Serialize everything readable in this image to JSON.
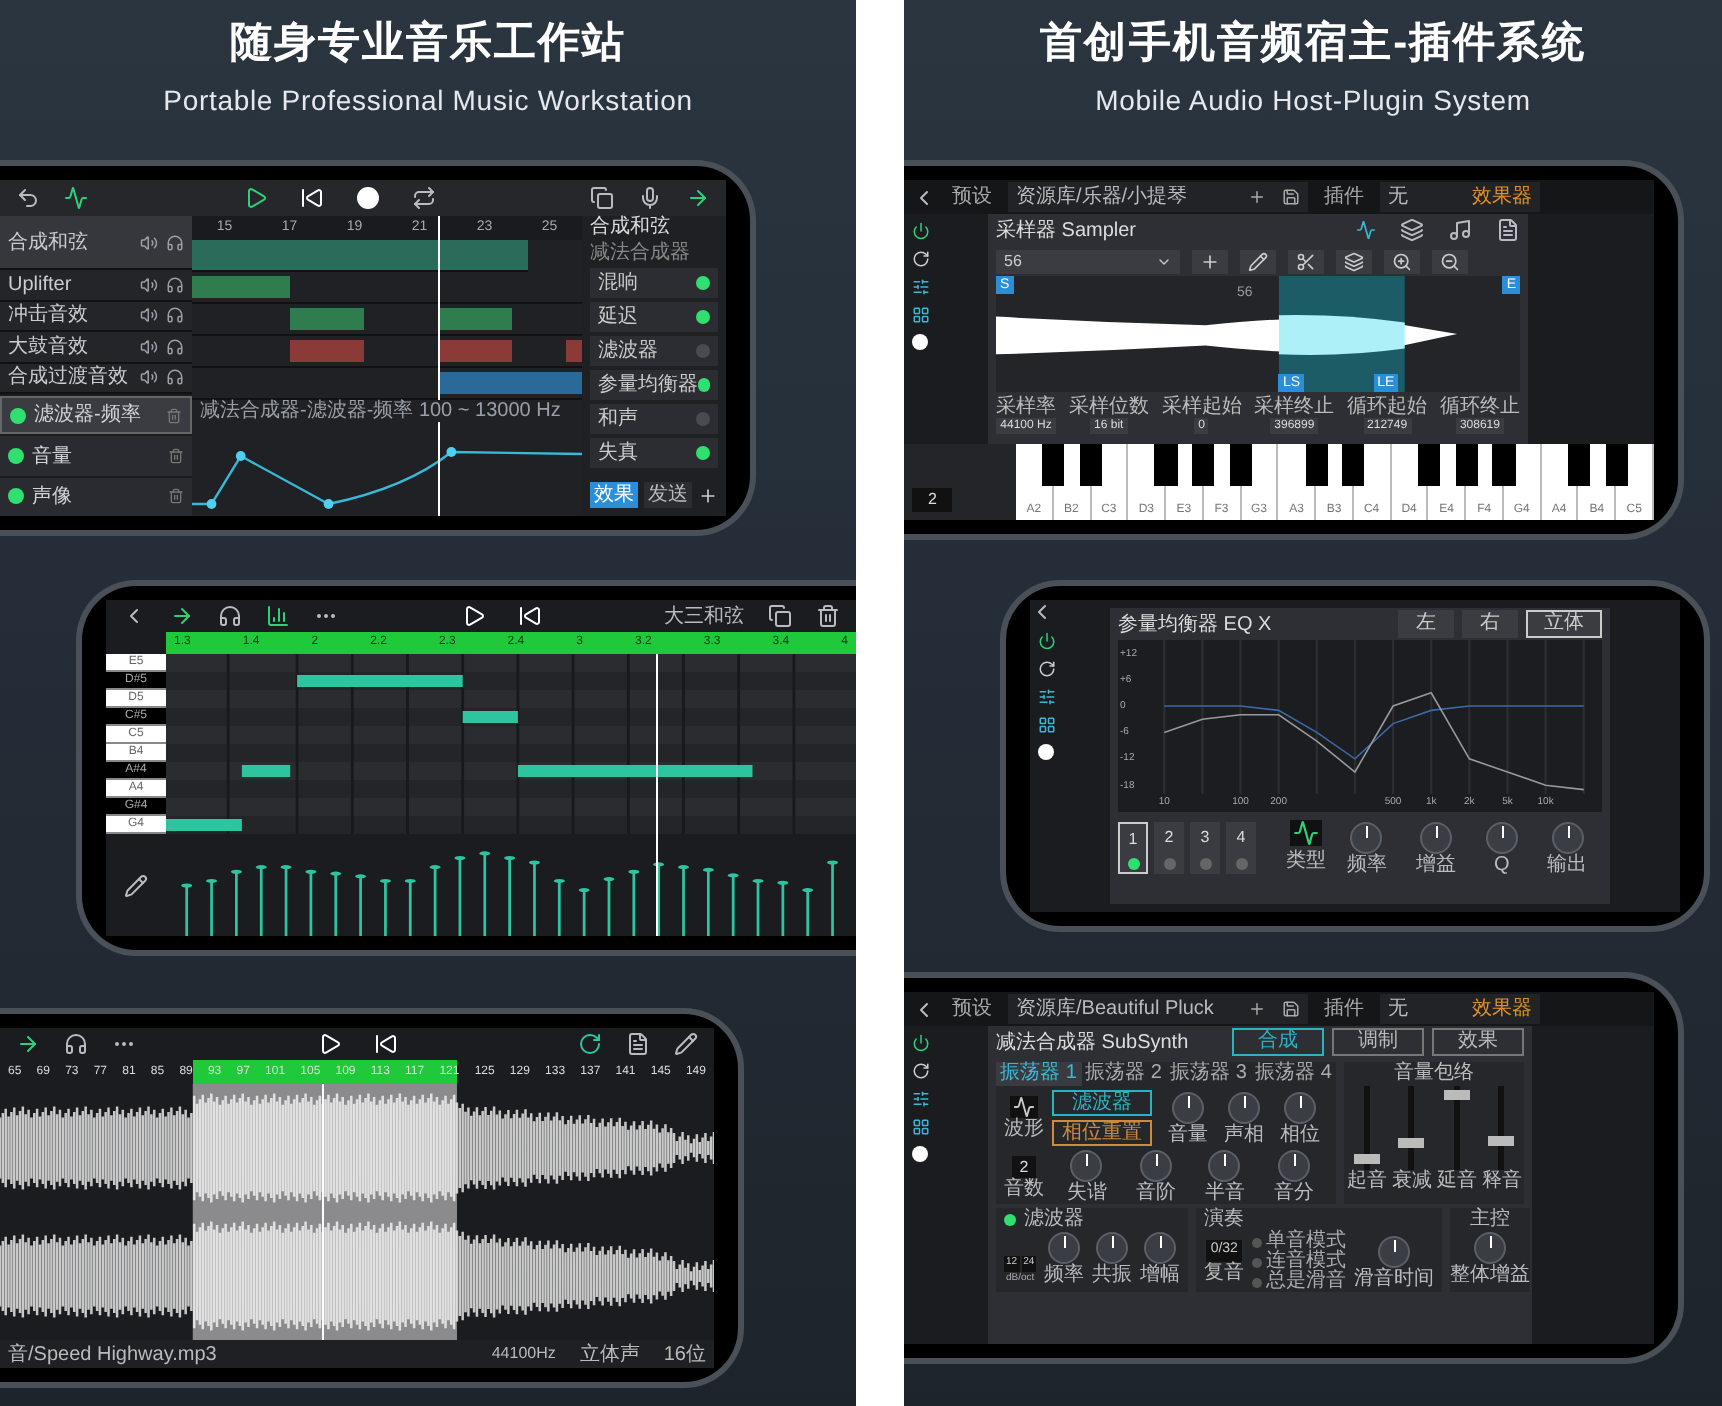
{
  "left_panel": {
    "title": "随身专业音乐工作站",
    "subtitle": "Portable Professional Music Workstation",
    "arranger": {
      "ruler": [
        "15",
        "17",
        "19",
        "21",
        "23",
        "25"
      ],
      "tracks": [
        {
          "name": "合成和弦",
          "selected": true
        },
        {
          "name": "Uplifter",
          "selected": false
        },
        {
          "name": "冲击音效",
          "selected": false
        },
        {
          "name": "大鼓音效",
          "selected": false
        },
        {
          "name": "合成过渡音效",
          "selected": false
        }
      ],
      "automation_lanes": [
        {
          "name": "滤波器-频率",
          "selected": true
        },
        {
          "name": "音量",
          "selected": false
        },
        {
          "name": "声像",
          "selected": false
        }
      ],
      "automation_label": "减法合成器-滤波器-频率 100 ~ 13000 Hz",
      "instrument": {
        "name": "合成和弦",
        "plugin": "减法合成器"
      },
      "effects": [
        {
          "name": "混响",
          "on": true
        },
        {
          "name": "延迟",
          "on": true
        },
        {
          "name": "滤波器",
          "on": false
        },
        {
          "name": "参量均衡器",
          "on": true
        },
        {
          "name": "和声",
          "on": false
        },
        {
          "name": "失真",
          "on": true
        }
      ],
      "tabs": [
        {
          "label": "效果",
          "selected": true
        },
        {
          "label": "发送",
          "selected": false
        }
      ]
    },
    "piano_roll": {
      "chord": "大三和弦",
      "ruler": [
        "1.3",
        "1.4",
        "2",
        "2.2",
        "2.3",
        "2.4",
        "3",
        "3.2",
        "3.3",
        "3.4",
        "4"
      ],
      "keys": [
        {
          "label": "E5",
          "kind": "white"
        },
        {
          "label": "D#5",
          "kind": "black"
        },
        {
          "label": "D5",
          "kind": "white"
        },
        {
          "label": "C#5",
          "kind": "black"
        },
        {
          "label": "C5",
          "kind": "white"
        },
        {
          "label": "B4",
          "kind": "white"
        },
        {
          "label": "A#4",
          "kind": "black"
        },
        {
          "label": "A4",
          "kind": "white"
        },
        {
          "label": "G#4",
          "kind": "black"
        },
        {
          "label": "G4",
          "kind": "white"
        }
      ]
    },
    "audio_editor": {
      "ruler": [
        "65",
        "69",
        "73",
        "77",
        "81",
        "85",
        "89",
        "93",
        "97",
        "101",
        "105",
        "109",
        "113",
        "117",
        "121",
        "125",
        "129",
        "133",
        "137",
        "141",
        "145",
        "149"
      ],
      "file": "音/Speed Highway.mp3",
      "sample_rate": "44100Hz",
      "channels": "立体声",
      "bit_depth": "16位"
    }
  },
  "right_panel": {
    "title": "首创手机音频宿主-插件系统",
    "subtitle": "Mobile Audio Host-Plugin System",
    "sampler": {
      "preset_label": "预设",
      "preset": "资源库/乐器/小提琴",
      "plugin_label": "插件",
      "plugin": "无",
      "effects_button": "效果器",
      "title": "采样器 Sampler",
      "sample": "56",
      "sample_marker": "56",
      "markers": [
        "S",
        "E",
        "LS",
        "LE"
      ],
      "params": [
        {
          "label": "采样率",
          "value": "44100 Hz"
        },
        {
          "label": "采样位数",
          "value": "16 bit"
        },
        {
          "label": "采样起始",
          "value": "0"
        },
        {
          "label": "采样终止",
          "value": "396899"
        },
        {
          "label": "循环起始",
          "value": "212749"
        },
        {
          "label": "循环终止",
          "value": "308619"
        }
      ],
      "octave": "2",
      "keys": [
        "A2",
        "B2",
        "C3",
        "D3",
        "E3",
        "F3",
        "G3",
        "A3",
        "B3",
        "C4",
        "D4",
        "E4",
        "F4",
        "G4",
        "A4",
        "B4",
        "C5"
      ]
    },
    "eq": {
      "title": "参量均衡器 EQ X",
      "channel_buttons": [
        {
          "label": "左",
          "selected": false
        },
        {
          "label": "右",
          "selected": false
        },
        {
          "label": "立体",
          "selected": true
        }
      ],
      "chart_data": {
        "type": "line",
        "grid": true,
        "ylim": [
          -20,
          15
        ],
        "categories": [
          "10",
          null,
          "100",
          "200",
          null,
          null,
          "500",
          "1k",
          "2k",
          "5k",
          "10k",
          null
        ],
        "yticks": [
          {
            "value": 12,
            "label": "+12"
          },
          {
            "value": 6,
            "label": "+6"
          },
          0,
          -6,
          -12,
          -18
        ],
        "series": [
          {
            "color": "#3a6aa8",
            "values": [
              0,
              0,
              0,
              -1,
              -6,
              -12,
              -4,
              -1,
              0,
              0,
              0,
              0
            ]
          },
          {
            "color": "#999999",
            "values": [
              -6,
              -3,
              -2,
              -2,
              -8,
              -15,
              0,
              3,
              -12,
              -15,
              -18,
              -19
            ]
          }
        ]
      },
      "bands": [
        {
          "label": "1",
          "selected": true
        },
        {
          "label": "2",
          "selected": false
        },
        {
          "label": "3",
          "selected": false
        },
        {
          "label": "4",
          "selected": false
        }
      ],
      "type_label": "类型",
      "knobs": [
        "频率",
        "增益",
        "Q",
        "输出"
      ]
    },
    "synth": {
      "preset_label": "预设",
      "preset": "资源库/Beautiful Pluck",
      "plugin_label": "插件",
      "plugin": "无",
      "effects_button": "效果器",
      "title": "减法合成器 SubSynth",
      "mode_tabs": [
        {
          "label": "合成",
          "selected": true
        },
        {
          "label": "调制",
          "selected": false
        },
        {
          "label": "效果",
          "selected": false
        }
      ],
      "osc_tabs": [
        {
          "label": "振荡器 1",
          "selected": true
        },
        {
          "label": "振荡器 2",
          "selected": false
        },
        {
          "label": "振荡器 3",
          "selected": false
        },
        {
          "label": "振荡器 4",
          "selected": false
        }
      ],
      "wave_label": "波形",
      "toggles": [
        {
          "label": "滤波器",
          "color": "#2bb3c0"
        },
        {
          "label": "相位重置",
          "color": "#d08a3a"
        }
      ],
      "knobs_row1": [
        "音量",
        "声相",
        "相位"
      ],
      "voices": "2",
      "voices_label": "音数",
      "knobs_row2": [
        "失谐",
        "音阶",
        "半音",
        "音分"
      ],
      "envelope_title": "音量包络",
      "faders": [
        {
          "label": "起音",
          "level": 0.08
        },
        {
          "label": "衰减",
          "level": 0.3
        },
        {
          "label": "延音",
          "level": 0.95
        },
        {
          "label": "释音",
          "level": 0.32
        }
      ],
      "filter": {
        "title": "滤波器",
        "on": true,
        "slopes": [
          "12",
          "24"
        ],
        "slope_unit": "dB/oct",
        "knobs": [
          "频率",
          "共振",
          "增幅"
        ]
      },
      "play": {
        "title": "演奏",
        "polyphony": "0/32",
        "polyphony_label": "复音",
        "modes": [
          {
            "label": "单音模式",
            "selected": false
          },
          {
            "label": "连音模式",
            "selected": false
          },
          {
            "label": "总是滑音",
            "selected": false
          }
        ],
        "knob": "滑音时间"
      },
      "master": {
        "title": "主控",
        "knob": "整体增益"
      }
    }
  }
}
